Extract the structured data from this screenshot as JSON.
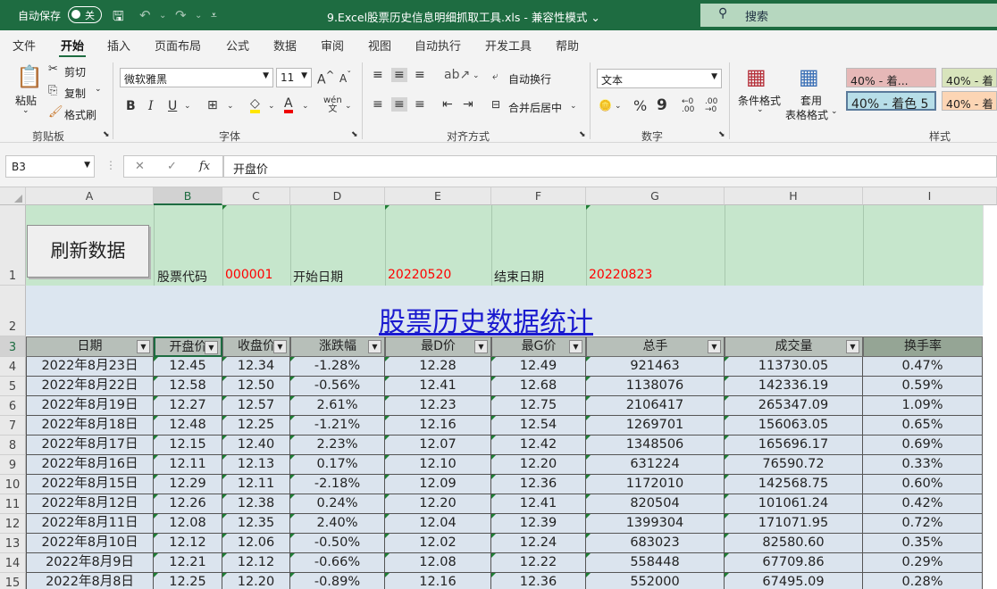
{
  "titlebar": {
    "autosave": "自动保存",
    "toggle": "关",
    "doc_title": "9.Excel股票历史信息明细抓取工具.xls  -  兼容性模式 ⌄",
    "search": "搜索"
  },
  "menu": [
    "文件",
    "开始",
    "插入",
    "页面布局",
    "公式",
    "数据",
    "审阅",
    "视图",
    "自动执行",
    "开发工具",
    "帮助"
  ],
  "ribbon": {
    "paste": "粘贴",
    "cut": "剪切",
    "copy": "复制",
    "format_painter": "格式刷",
    "clipboard": "剪贴板",
    "font_name": "微软雅黑",
    "font_size": "11",
    "font_group": "字体",
    "wrap": "自动换行",
    "merge": "合并后居中",
    "align_group": "对齐方式",
    "number_format": "文本",
    "number_group": "数字",
    "cond_format": "条件格式",
    "table_format_1": "套用",
    "table_format_2": "表格格式",
    "style_group": "样式",
    "styles": [
      "40% - 着...",
      "40% - 着",
      "40% - 着色 5",
      "40% - 着"
    ]
  },
  "formula_bar": {
    "name_box": "B3",
    "formula": "开盘价"
  },
  "columns": [
    "A",
    "B",
    "C",
    "D",
    "E",
    "F",
    "G",
    "H",
    "I"
  ],
  "rows": [
    "1",
    "2",
    "3",
    "4",
    "5",
    "6",
    "7",
    "8",
    "9",
    "10",
    "11",
    "12",
    "13",
    "14",
    "15"
  ],
  "sheet": {
    "refresh_button": "刷新数据",
    "stock_code_label": "股票代码",
    "stock_code": "000001",
    "start_label": "开始日期",
    "start_date": "20220520",
    "end_label": "结束日期",
    "end_date": "20220823",
    "title": "股票历史数据统计"
  },
  "table": {
    "headers": [
      "日期",
      "开盘价",
      "收盘价",
      "涨跌幅",
      "最D价",
      "最G价",
      "总手",
      "成交量",
      "换手率"
    ],
    "rows": [
      [
        "2022年8月23日",
        "12.45",
        "12.34",
        "-1.28%",
        "12.28",
        "12.49",
        "921463",
        "113730.05",
        "0.47%"
      ],
      [
        "2022年8月22日",
        "12.58",
        "12.50",
        "-0.56%",
        "12.41",
        "12.68",
        "1138076",
        "142336.19",
        "0.59%"
      ],
      [
        "2022年8月19日",
        "12.27",
        "12.57",
        "2.61%",
        "12.23",
        "12.75",
        "2106417",
        "265347.09",
        "1.09%"
      ],
      [
        "2022年8月18日",
        "12.48",
        "12.25",
        "-1.21%",
        "12.16",
        "12.54",
        "1269701",
        "156063.05",
        "0.65%"
      ],
      [
        "2022年8月17日",
        "12.15",
        "12.40",
        "2.23%",
        "12.07",
        "12.42",
        "1348506",
        "165696.17",
        "0.69%"
      ],
      [
        "2022年8月16日",
        "12.11",
        "12.13",
        "0.17%",
        "12.10",
        "12.20",
        "631224",
        "76590.72",
        "0.33%"
      ],
      [
        "2022年8月15日",
        "12.29",
        "12.11",
        "-2.18%",
        "12.09",
        "12.36",
        "1172010",
        "142568.75",
        "0.60%"
      ],
      [
        "2022年8月12日",
        "12.26",
        "12.38",
        "0.24%",
        "12.20",
        "12.41",
        "820504",
        "101061.24",
        "0.42%"
      ],
      [
        "2022年8月11日",
        "12.08",
        "12.35",
        "2.40%",
        "12.04",
        "12.39",
        "1399304",
        "171071.95",
        "0.72%"
      ],
      [
        "2022年8月10日",
        "12.12",
        "12.06",
        "-0.50%",
        "12.02",
        "12.24",
        "683023",
        "82580.60",
        "0.35%"
      ],
      [
        "2022年8月9日",
        "12.21",
        "12.12",
        "-0.66%",
        "12.08",
        "12.22",
        "558448",
        "67709.86",
        "0.29%"
      ],
      [
        "2022年8月8日",
        "12.25",
        "12.20",
        "-0.89%",
        "12.16",
        "12.36",
        "552000",
        "67495.09",
        "0.28%"
      ]
    ]
  },
  "colors": {
    "excel_green": "#1e6c41",
    "stock_red": "#ff0000",
    "title_blue": "#1a1acf",
    "row1_bg": "#c6e6cc",
    "row2_bg": "#dce6f0",
    "data_bg": "#dbe4ee",
    "header_bg": "#b7bfb9"
  }
}
